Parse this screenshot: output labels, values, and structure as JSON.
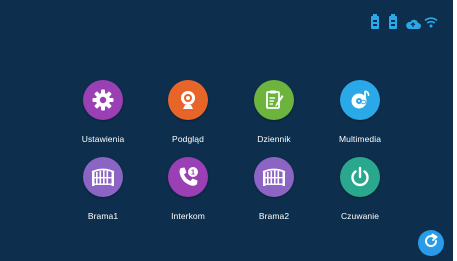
{
  "status_bar": {
    "icons": [
      "door-lock-1-icon",
      "door-lock-2-icon",
      "cloud-icon",
      "wifi-icon"
    ],
    "color": "#2aa8e8"
  },
  "tiles": [
    {
      "id": "settings",
      "label": "Ustawienia",
      "icon": "gear-icon",
      "color": "#9b3fb5"
    },
    {
      "id": "preview",
      "label": "Podgląd",
      "icon": "webcam-icon",
      "color": "#e8652a"
    },
    {
      "id": "log",
      "label": "Dziennik",
      "icon": "notepad-icon",
      "color": "#6db43e"
    },
    {
      "id": "multimedia",
      "label": "Multimedia",
      "icon": "music-note-icon",
      "color": "#2aa8e8"
    },
    {
      "id": "gate1",
      "label": "Brama1",
      "icon": "gate-icon",
      "color": "#8b64c4"
    },
    {
      "id": "intercom",
      "label": "Interkom",
      "icon": "phone-icon",
      "color": "#9b3fb5",
      "badge": "1"
    },
    {
      "id": "gate2",
      "label": "Brama2",
      "icon": "gate-icon",
      "color": "#8b64c4"
    },
    {
      "id": "standby",
      "label": "Czuwanie",
      "icon": "power-icon",
      "color": "#2aa88e"
    }
  ],
  "refresh_button": {
    "icon": "refresh-icon",
    "color": "#2a9be8"
  }
}
